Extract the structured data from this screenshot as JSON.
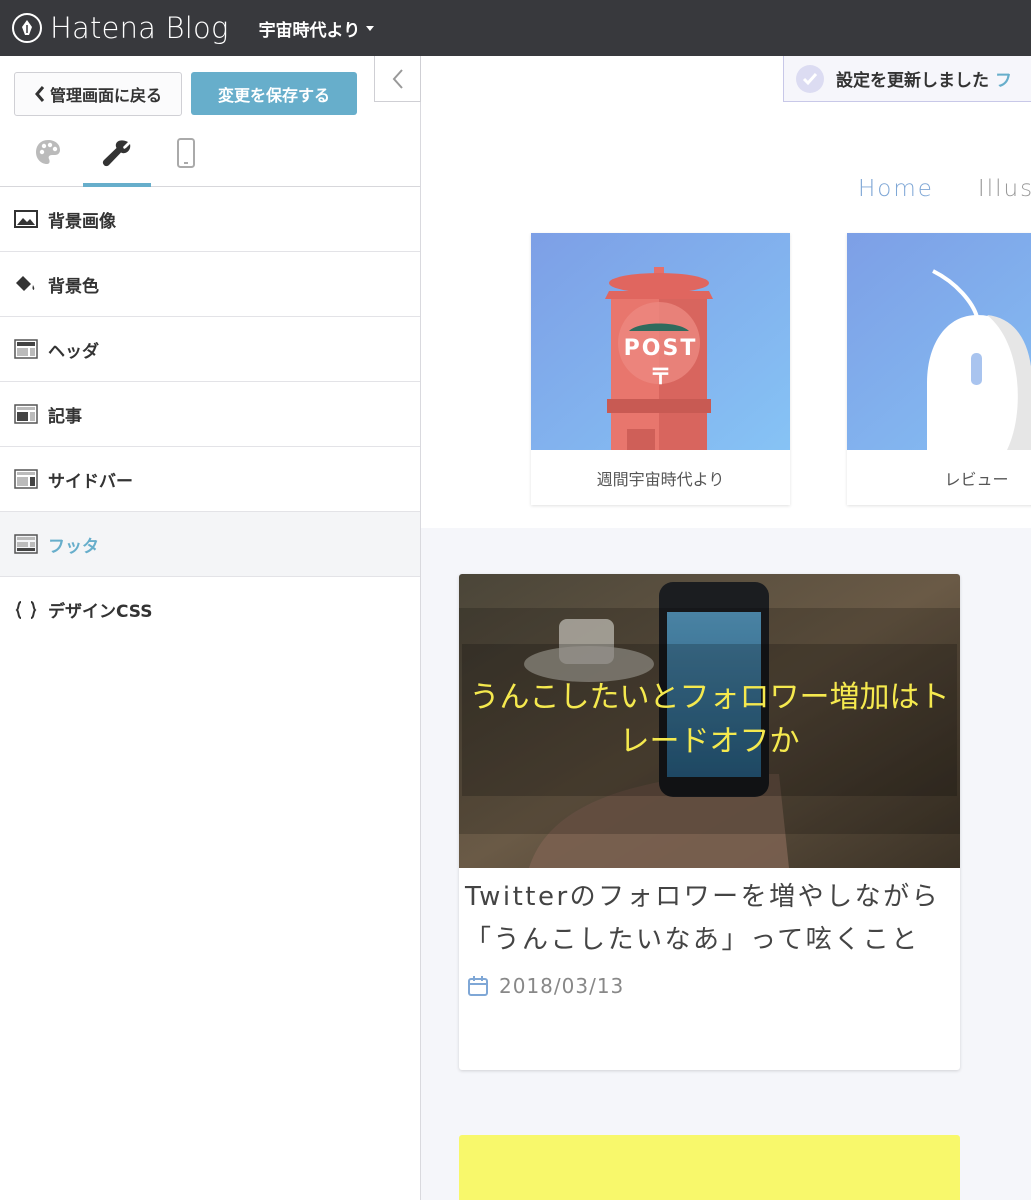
{
  "topbar": {
    "logo_text": "Hatena Blog",
    "blog_name": "宇宙時代より"
  },
  "sidebar": {
    "back_label": "管理画面に戻る",
    "save_label": "変更を保存する",
    "tabs": [
      {
        "icon": "palette-icon"
      },
      {
        "icon": "wrench-icon",
        "active": true
      },
      {
        "icon": "smartphone-icon"
      }
    ],
    "items": [
      {
        "label": "背景画像",
        "icon": "image-icon"
      },
      {
        "label": "背景色",
        "icon": "paint-bucket-icon"
      },
      {
        "label": "ヘッダ",
        "icon": "layout-header-icon"
      },
      {
        "label": "記事",
        "icon": "layout-article-icon"
      },
      {
        "label": "サイドバー",
        "icon": "layout-sidebar-icon"
      },
      {
        "label": "フッタ",
        "icon": "layout-footer-icon",
        "active": true
      },
      {
        "label": "デザインCSS",
        "icon": "braces-icon"
      }
    ]
  },
  "preview": {
    "notice_text": "設定を更新しました",
    "notice_link": "フ",
    "nav": [
      "Home",
      "Illust"
    ],
    "categories": [
      {
        "caption": "週間宇宙時代より",
        "thumb_text": "POST"
      },
      {
        "caption": "レビュー"
      }
    ],
    "post": {
      "thumb_title": "うんこしたいとフォロワー増加はトレードオフか",
      "title": "Twitterのフォロワーを増やしながら「うんこしたいなあ」って呟くこと",
      "date": "2018/03/13"
    }
  },
  "colors": {
    "topbar": "#38393d",
    "accent": "#67aecb",
    "thumb_title": "#f5e94e",
    "next_card": "#f8f86b"
  }
}
